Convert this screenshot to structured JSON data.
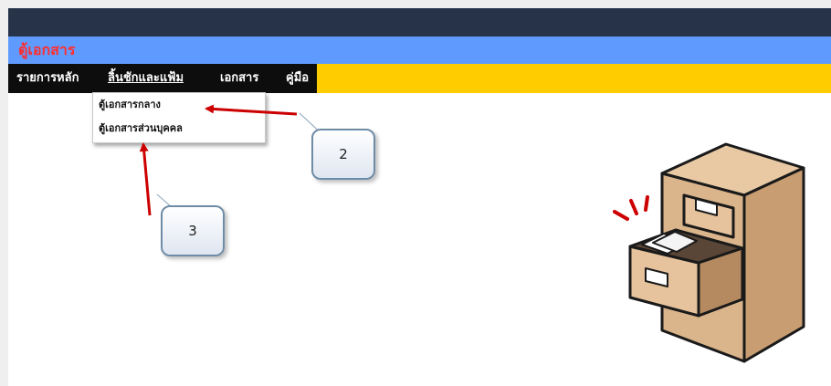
{
  "app": {
    "title": "ตู้เอกสาร"
  },
  "menu": {
    "items": [
      {
        "label": "รายการหลัก"
      },
      {
        "label": "ลิ้นชักและแฟ้ม"
      },
      {
        "label": "เอกสาร"
      },
      {
        "label": "คู่มือ"
      }
    ]
  },
  "dropdown": {
    "items": [
      {
        "label": "ตู้เอกสารกลาง"
      },
      {
        "label": "ตู้เอกสารส่วนบุคคล"
      }
    ]
  },
  "callouts": [
    {
      "text": "2"
    },
    {
      "text": "3"
    }
  ],
  "colors": {
    "topbar": "#273349",
    "titlebar": "#5f9bff",
    "title_text": "#ff2d2d",
    "menubar": "#ffcc00",
    "arrow": "#cc0000"
  }
}
